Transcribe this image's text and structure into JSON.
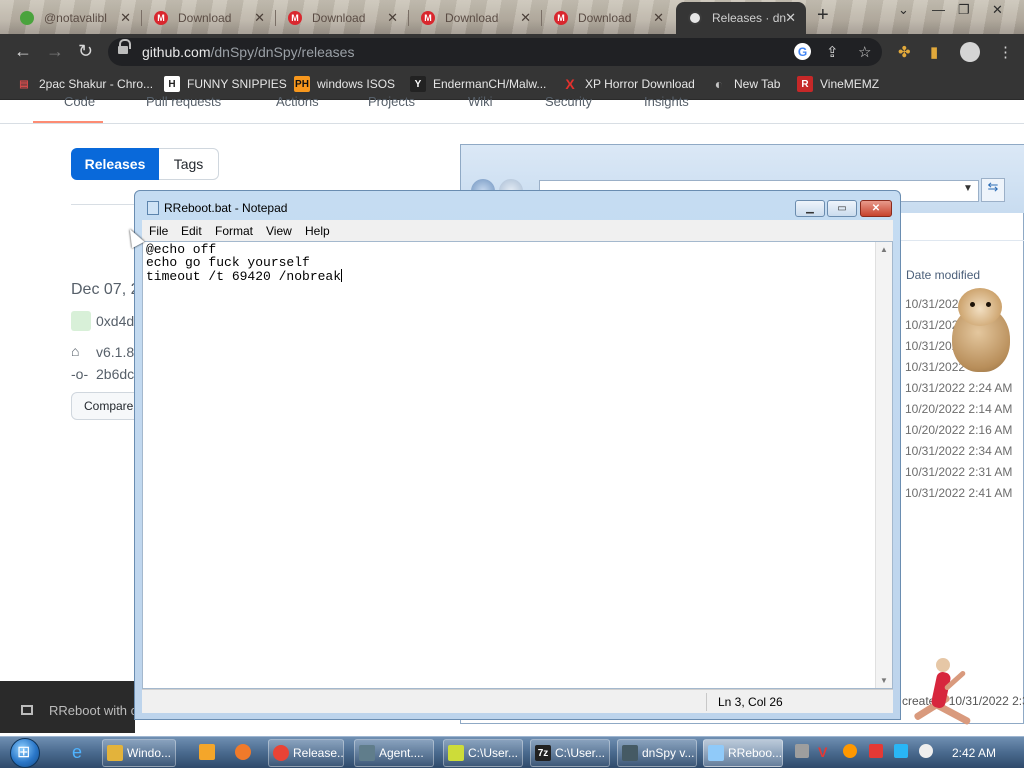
{
  "browser": {
    "tabs": [
      {
        "label": "@notavalibl",
        "icon": "green-splat-icon"
      },
      {
        "label": "Download",
        "icon": "mega-icon"
      },
      {
        "label": "Download",
        "icon": "mega-icon"
      },
      {
        "label": "Download",
        "icon": "mega-icon"
      },
      {
        "label": "Download",
        "icon": "mega-icon"
      },
      {
        "label": "Releases · dn",
        "icon": "github-icon",
        "active": true
      }
    ],
    "close_glyph": "✕",
    "new_tab_glyph": "+",
    "url_host": "github.com",
    "url_path": "/dnSpy/dnSpy/releases",
    "bookmarks": [
      {
        "label": "2pac Shakur - Chro...",
        "icon_text": "▤",
        "icon_color": "#d24b4b"
      },
      {
        "label": "FUNNY SNIPPIES",
        "icon_text": "H",
        "icon_color": "#ffffff"
      },
      {
        "label": "windows ISOS",
        "icon_text": "PH",
        "icon_color": "#f7971d"
      },
      {
        "label": "EndermanCH/Malw...",
        "icon_text": "Y",
        "icon_color": "#222222"
      },
      {
        "label": "XP Horror Download",
        "icon_text": "X",
        "icon_color": "#e3312d"
      },
      {
        "label": "New Tab",
        "icon_text": "◐",
        "icon_color": "#9e9e9e"
      },
      {
        "label": "VineMEMZ",
        "icon_text": "R",
        "icon_color": "#c62828"
      }
    ]
  },
  "github": {
    "nav_fragments": [
      "Code",
      "Pull requests",
      "Actions",
      "Projects",
      "Wiki",
      "Security",
      "Insights"
    ],
    "releases_label": "Releases",
    "tags_label": "Tags",
    "date": "Dec 07, 2",
    "author": "0xd4d",
    "version": "v6.1.8",
    "commit": "2b6dc",
    "compare_label": "Compare"
  },
  "explorer": {
    "column_header": "Date modified",
    "dates": [
      "10/31/2022",
      "10/31/2022",
      "10/31/2022",
      "10/31/2022",
      "10/31/2022 2:24 AM",
      "10/20/2022 2:14 AM",
      "10/20/2022 2:16 AM",
      "10/31/2022 2:34 AM",
      "10/31/2022 2:31 AM",
      "10/31/2022 2:41 AM"
    ],
    "status_text": "created: 10/31/2022 2:3"
  },
  "toast": {
    "label": "RReboot with c"
  },
  "notepad": {
    "title": "RReboot.bat - Notepad",
    "menu": [
      "File",
      "Edit",
      "Format",
      "View",
      "Help"
    ],
    "lines": [
      "@echo off",
      "echo go fuck yourself",
      "timeout /t 69420 /nobreak"
    ],
    "status": "Ln 3, Col 26"
  },
  "taskbar": {
    "items": [
      {
        "label": "Windo...",
        "icon_color": "#e3b33b"
      },
      {
        "label": "Release...",
        "icon_color": "#ea4335"
      },
      {
        "label": "Agent....",
        "icon_color": "#607d8b"
      },
      {
        "label": "C:\\User...",
        "icon_color": "#cddc39"
      },
      {
        "label": "C:\\User...",
        "icon_color": "#212121"
      },
      {
        "label": "dnSpy v...",
        "icon_color": "#455a64"
      },
      {
        "label": "RReboo...",
        "icon_color": "#90caf9",
        "active": true
      }
    ],
    "clock": "2:42 AM"
  },
  "colors": {
    "accent": "#0969da",
    "chrome_dark": "#353535",
    "taskbar": "#4a6a8e"
  }
}
